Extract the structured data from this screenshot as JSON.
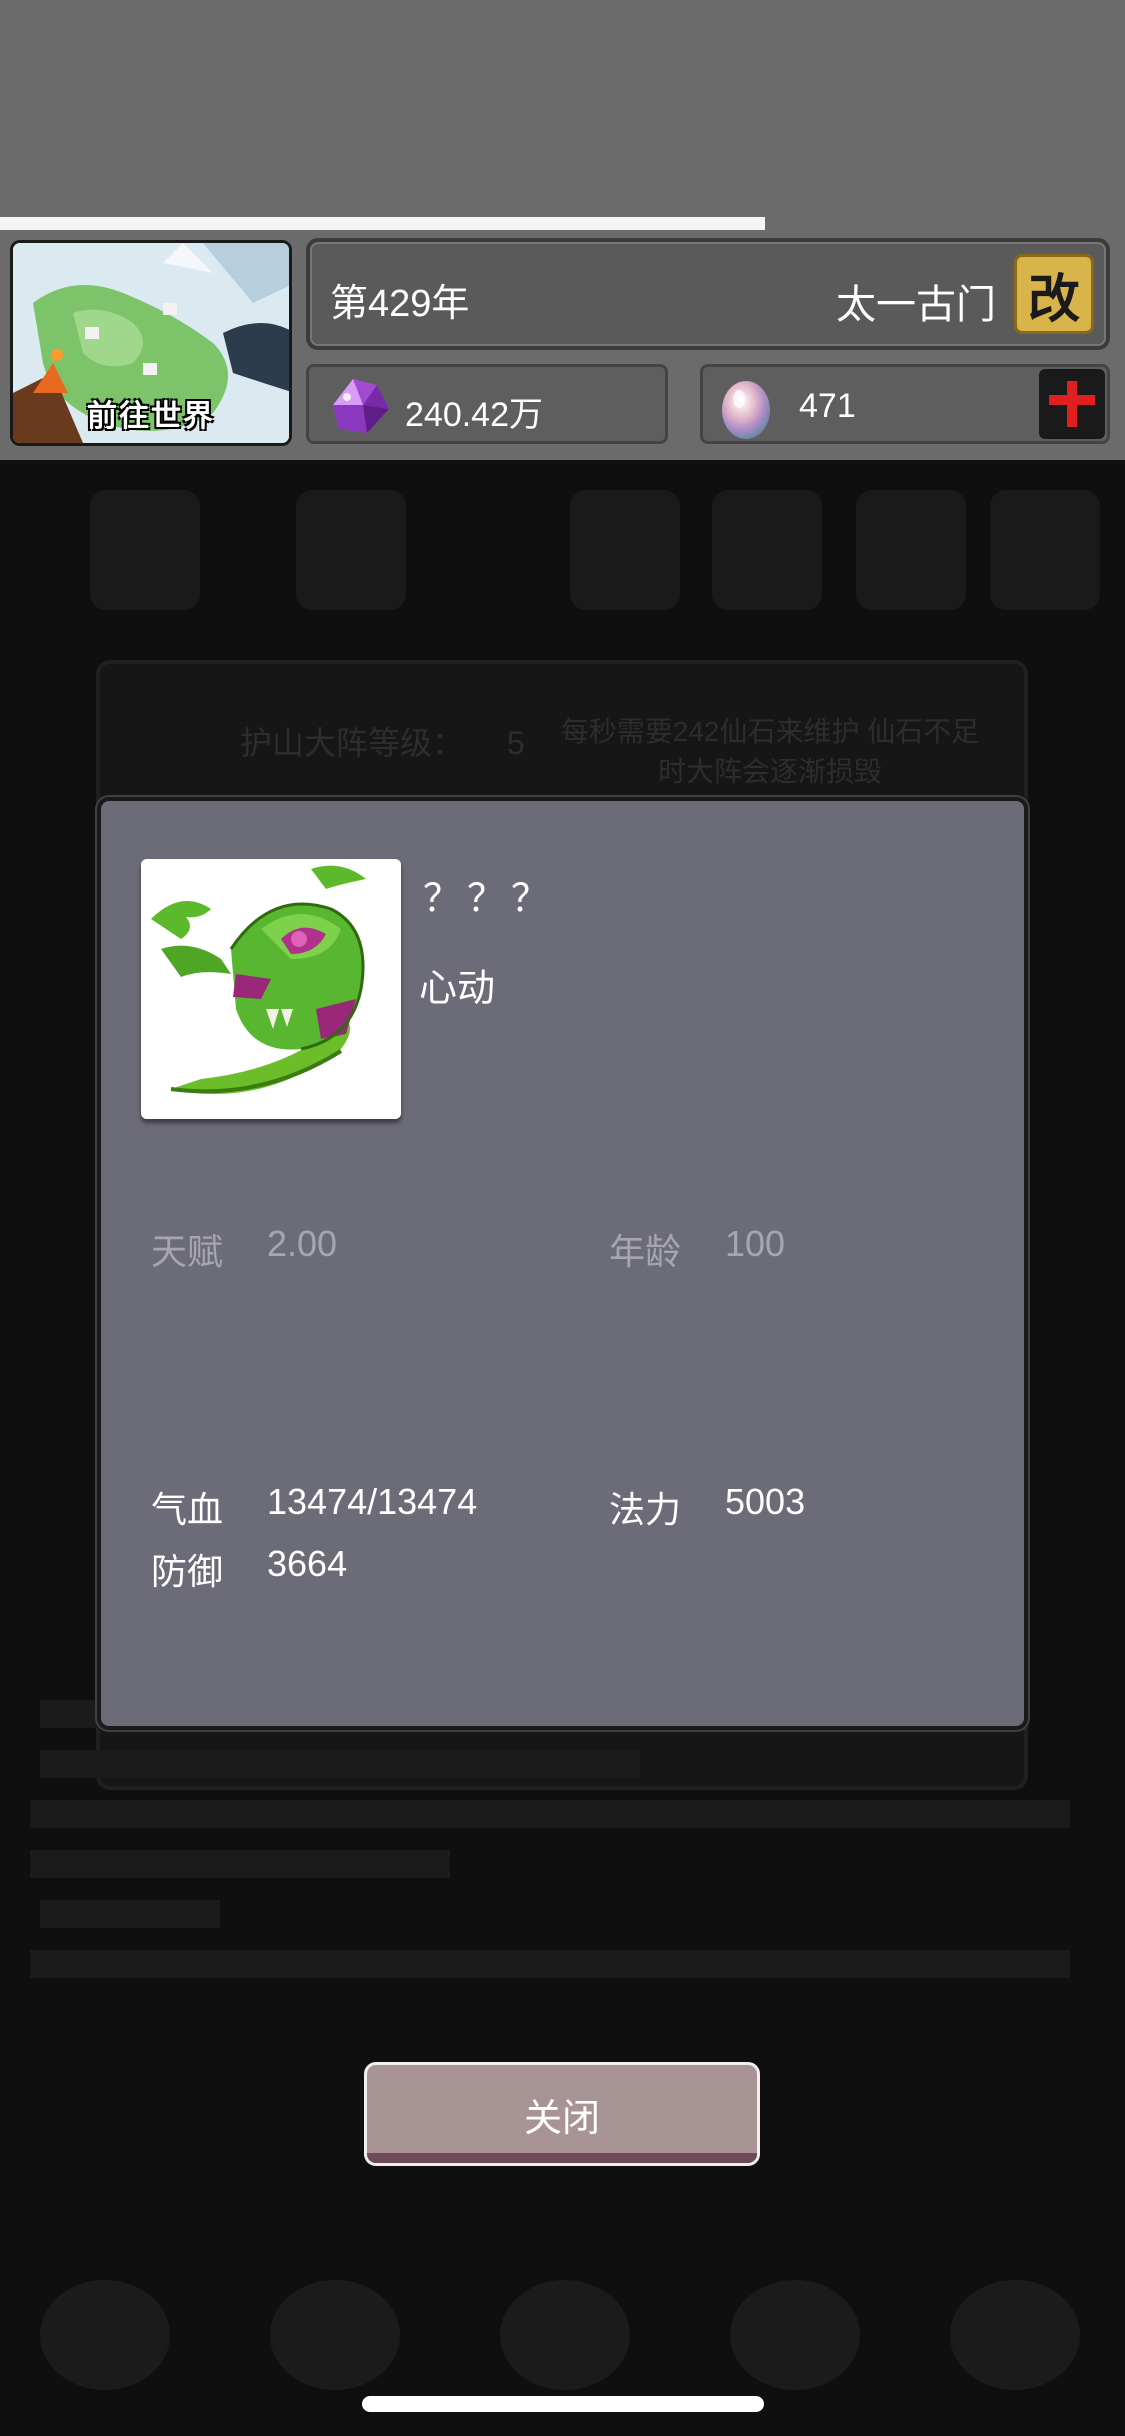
{
  "header": {
    "world_button_label": "前往世界",
    "year": "第429年",
    "sect_name": "太一古门",
    "rename_label": "改",
    "spirit_stones": "240.42万",
    "eggs": "471",
    "progress_fraction": 0.68
  },
  "background": {
    "level_label": "护山大阵等级：",
    "level_value": "5",
    "notice": "每秒需要242仙石来维护 仙石不足时大阵会逐渐损毁"
  },
  "modal": {
    "name": "？？？",
    "realm": "心动",
    "stats": {
      "talent_label": "天赋",
      "talent_value": "2.00",
      "age_label": "年龄",
      "age_value": "100",
      "hp_label": "气血",
      "hp_value": "13474/13474",
      "mana_label": "法力",
      "mana_value": "5003",
      "defense_label": "防御",
      "defense_value": "3664"
    }
  },
  "close_button_label": "关闭",
  "icons": {
    "spirit_stone": "purple-crystal-icon",
    "egg": "spirit-egg-icon",
    "add": "red-plus-icon",
    "portrait": "green-scorpion-monster"
  },
  "colors": {
    "modal_bg": "#6c6b78",
    "close_btn": "#a89494",
    "rename_btn": "#d8b44a",
    "add_plus": "#e02020"
  }
}
